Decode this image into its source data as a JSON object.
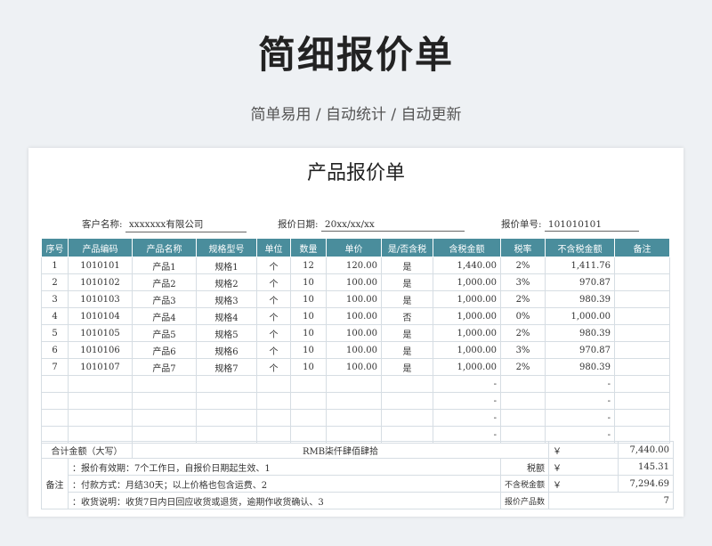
{
  "banner": {
    "title": "简细报价单",
    "subtitle": "简单易用 / 自动统计 / 自动更新"
  },
  "doc": {
    "title": "产品报价单",
    "customer_label": "客户名称:",
    "customer_value": "xxxxxxx有限公司",
    "date_label": "报价日期:",
    "date_value": "20xx/xx/xx",
    "quote_no_label": "报价单号:",
    "quote_no_value": "101010101"
  },
  "table": {
    "headers": [
      "序号",
      "产品编码",
      "产品名称",
      "规格型号",
      "单位",
      "数量",
      "单价",
      "是/否含税",
      "含税金额",
      "税率",
      "不含税金额",
      "备注"
    ],
    "rows": [
      [
        "1",
        "1010101",
        "产品1",
        "规格1",
        "个",
        "12",
        "120.00",
        "是",
        "1,440.00",
        "2%",
        "1,411.76",
        ""
      ],
      [
        "2",
        "1010102",
        "产品2",
        "规格2",
        "个",
        "10",
        "100.00",
        "是",
        "1,000.00",
        "3%",
        "970.87",
        ""
      ],
      [
        "3",
        "1010103",
        "产品3",
        "规格3",
        "个",
        "10",
        "100.00",
        "是",
        "1,000.00",
        "2%",
        "980.39",
        ""
      ],
      [
        "4",
        "1010104",
        "产品4",
        "规格4",
        "个",
        "10",
        "100.00",
        "否",
        "1,000.00",
        "0%",
        "1,000.00",
        ""
      ],
      [
        "5",
        "1010105",
        "产品5",
        "规格5",
        "个",
        "10",
        "100.00",
        "是",
        "1,000.00",
        "2%",
        "980.39",
        ""
      ],
      [
        "6",
        "1010106",
        "产品6",
        "规格6",
        "个",
        "10",
        "100.00",
        "是",
        "1,000.00",
        "3%",
        "970.87",
        ""
      ],
      [
        "7",
        "1010107",
        "产品7",
        "规格7",
        "个",
        "10",
        "100.00",
        "是",
        "1,000.00",
        "2%",
        "980.39",
        ""
      ],
      [
        "",
        "",
        "",
        "",
        "",
        "",
        "",
        "",
        "-",
        "",
        "-",
        ""
      ],
      [
        "",
        "",
        "",
        "",
        "",
        "",
        "",
        "",
        "-",
        "",
        "-",
        ""
      ],
      [
        "",
        "",
        "",
        "",
        "",
        "",
        "",
        "",
        "-",
        "",
        "-",
        ""
      ],
      [
        "",
        "",
        "",
        "",
        "",
        "",
        "",
        "",
        "-",
        "",
        "-",
        ""
      ]
    ]
  },
  "footer": {
    "total_label": "合计金额（大写）",
    "total_words": "RMB柒仟肆佰肆拾",
    "currency": "￥",
    "total_value": "7,440.00",
    "notes_label": "备注",
    "note1": "：报价有效期：7个工作日，自报价日期起生效、1",
    "note2": "：付款方式：月结30天；以上价格也包含运费、2",
    "note3": "：收货说明：收货7日内日回应收货或退货，逾期作收货确认、3",
    "tax_label": "税额",
    "tax_value": "145.31",
    "pretax_label": "不含税金额",
    "pretax_value": "7,294.69",
    "count_label": "报价产品数",
    "count_value": "7"
  },
  "colors": {
    "header_bg": "#4a8d9c",
    "page_bg": "#eef1f4"
  }
}
